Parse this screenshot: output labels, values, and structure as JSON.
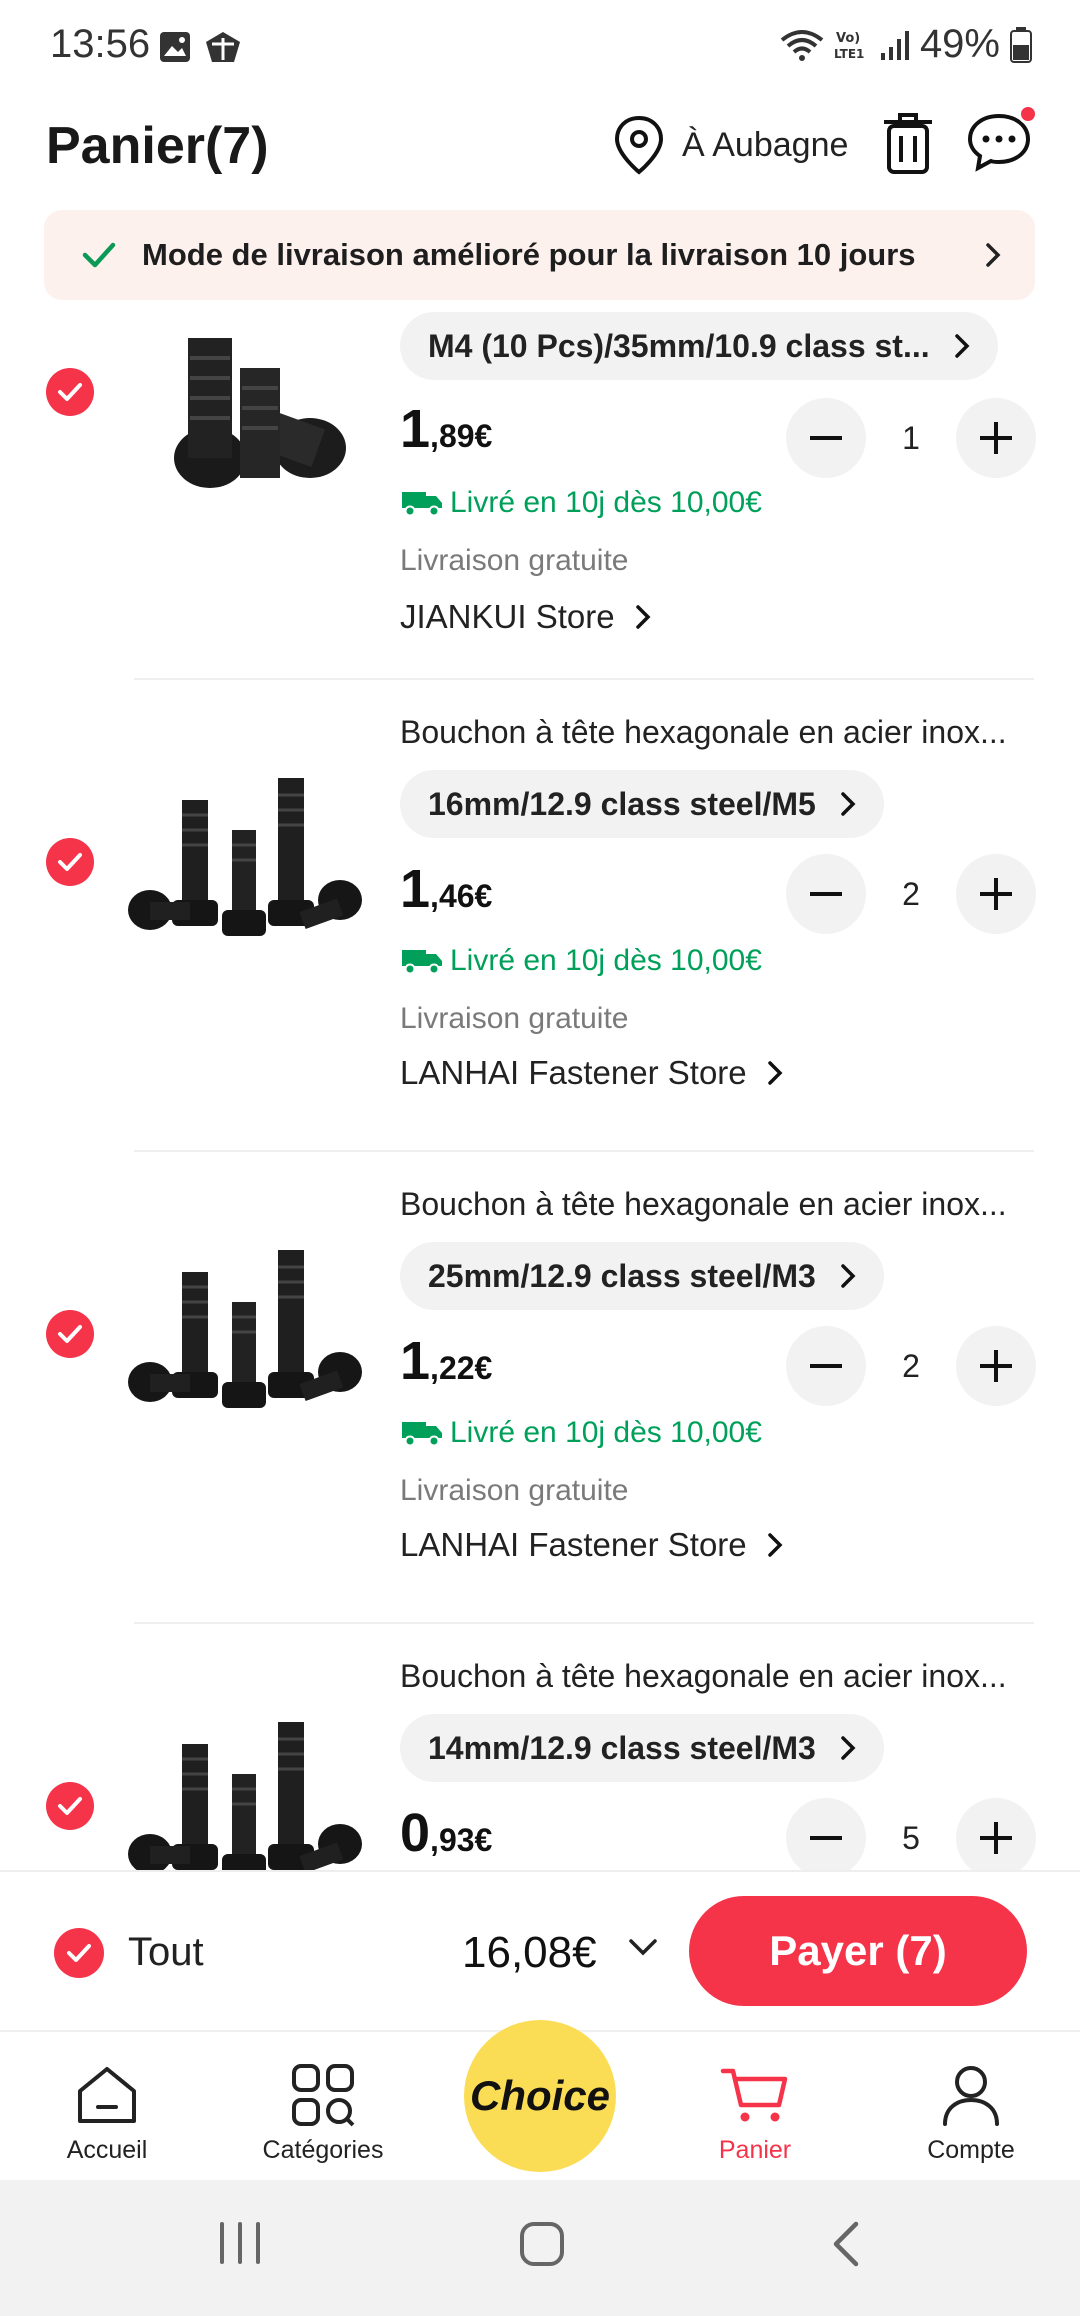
{
  "status_bar": {
    "time": "13:56",
    "battery": "49%"
  },
  "header": {
    "title": "Panier(7)",
    "location": "À Aubagne"
  },
  "banner": {
    "text": "Mode de livraison amélioré pour la livraison 10 jours"
  },
  "items": [
    {
      "name": "",
      "sku": "M4 (10 Pcs)/35mm/10.9 class st...",
      "price_int": "1",
      "price_dec": ",89€",
      "quantity": "1",
      "shipping": "Livré en 10j dès 10,00€",
      "free": "Livraison gratuite",
      "store": "JIANKUI Store"
    },
    {
      "name": "Bouchon à tête hexagonale en acier inox...",
      "sku": "16mm/12.9 class steel/M5",
      "price_int": "1",
      "price_dec": ",46€",
      "quantity": "2",
      "shipping": "Livré en 10j dès 10,00€",
      "free": "Livraison gratuite",
      "store": "LANHAI Fastener Store"
    },
    {
      "name": "Bouchon à tête hexagonale en acier inox...",
      "sku": "25mm/12.9 class steel/M3",
      "price_int": "1",
      "price_dec": ",22€",
      "quantity": "2",
      "shipping": "Livré en 10j dès 10,00€",
      "free": "Livraison gratuite",
      "store": "LANHAI Fastener Store"
    },
    {
      "name": "Bouchon à tête hexagonale en acier inox...",
      "sku": "14mm/12.9 class steel/M3",
      "price_int": "0",
      "price_dec": ",93€",
      "quantity": "5",
      "shipping": "",
      "free": "",
      "store": ""
    }
  ],
  "summary": {
    "select_all": "Tout",
    "total": "16,08€",
    "pay_label": "Payer (7)"
  },
  "nav": {
    "home": "Accueil",
    "categories": "Catégories",
    "choice": "Choice",
    "cart": "Panier",
    "account": "Compte"
  },
  "colors": {
    "accent": "#f53349",
    "shipping_green": "#00a05a",
    "choice_yellow": "#fbdd55"
  }
}
